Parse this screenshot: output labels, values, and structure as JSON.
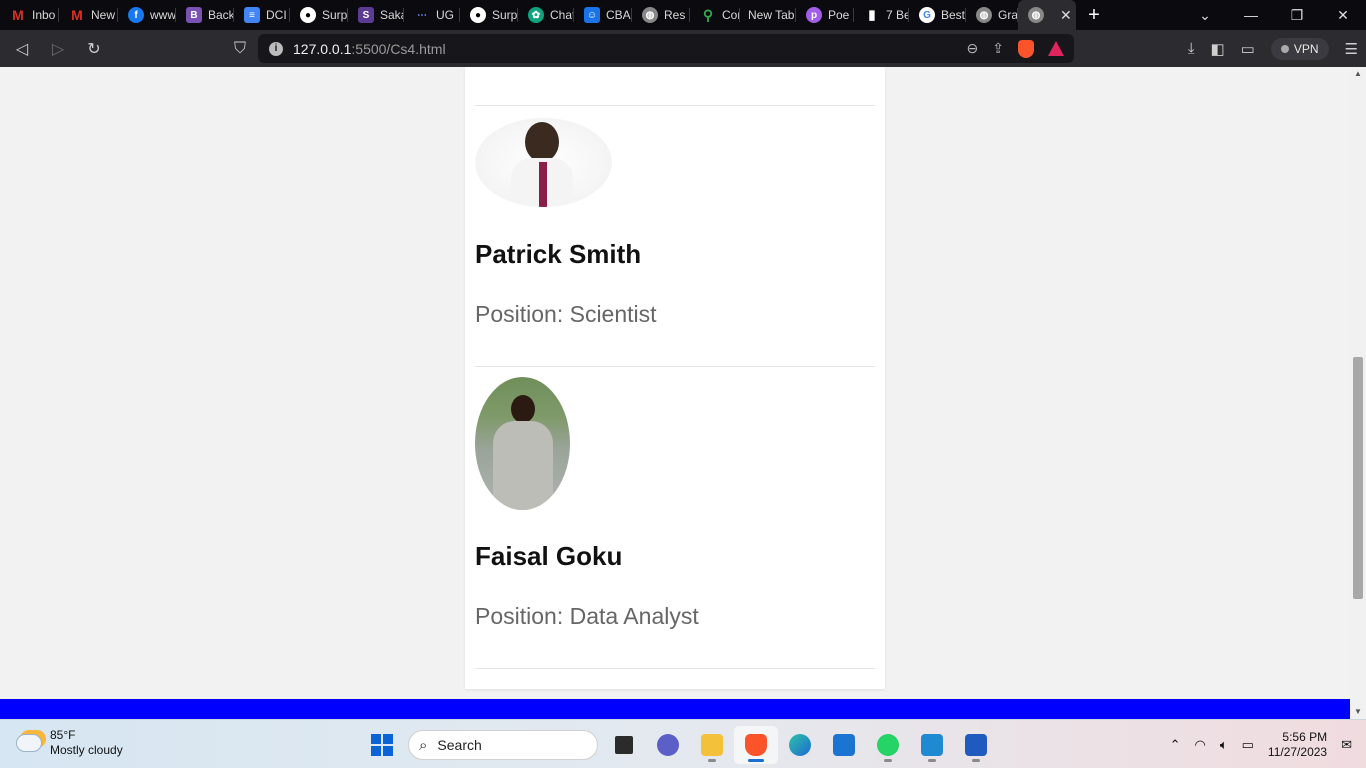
{
  "browser": {
    "tabs": [
      {
        "label": "Inbo",
        "icon": "gmail-icon",
        "color": "#d93025"
      },
      {
        "label": "New",
        "icon": "gmail-icon",
        "color": "#d93025"
      },
      {
        "label": "www",
        "icon": "facebook-icon",
        "color": "#1877f2"
      },
      {
        "label": "Back",
        "icon": "bootstrap-icon",
        "color": "#7952b3"
      },
      {
        "label": "DCI",
        "icon": "docs-icon",
        "color": "#4285f4"
      },
      {
        "label": "Surp",
        "icon": "github-icon",
        "color": "#ffffff"
      },
      {
        "label": "Saka",
        "icon": "sakai-icon",
        "color": "#5c3c92"
      },
      {
        "label": "UG",
        "icon": "ug-icon",
        "color": "#3b5bdb"
      },
      {
        "label": "Surp",
        "icon": "github-icon",
        "color": "#ffffff"
      },
      {
        "label": "Chat",
        "icon": "chatgpt-icon",
        "color": "#10a37f"
      },
      {
        "label": "CBA",
        "icon": "contacts-icon",
        "color": "#1a73e8"
      },
      {
        "label": "Res",
        "icon": "globe-icon",
        "color": "#888888"
      },
      {
        "label": "Con",
        "icon": "maps-icon",
        "color": "#34a853"
      },
      {
        "label": "New Tab",
        "icon": "",
        "color": ""
      },
      {
        "label": "Poe",
        "icon": "poe-icon",
        "color": "#a35ee8"
      },
      {
        "label": "7 Be",
        "icon": "document-icon",
        "color": "#ffffff"
      },
      {
        "label": "Best",
        "icon": "google-icon",
        "color": "#ffffff"
      },
      {
        "label": "Gra",
        "icon": "globe-icon",
        "color": "#888888"
      }
    ],
    "address": {
      "host": "127.0.0.1",
      "rest": ":5500/Cs4.html"
    },
    "vpn_label": "VPN"
  },
  "members": [
    {
      "name": "Patrick Smith",
      "position": "Position: Scientist"
    },
    {
      "name": "Faisal Goku",
      "position": "Position: Data Analyst"
    }
  ],
  "taskbar": {
    "weather": {
      "temp": "85°F",
      "condition": "Mostly cloudy"
    },
    "search_placeholder": "Search",
    "time": "5:56 PM",
    "date": "11/27/2023"
  }
}
